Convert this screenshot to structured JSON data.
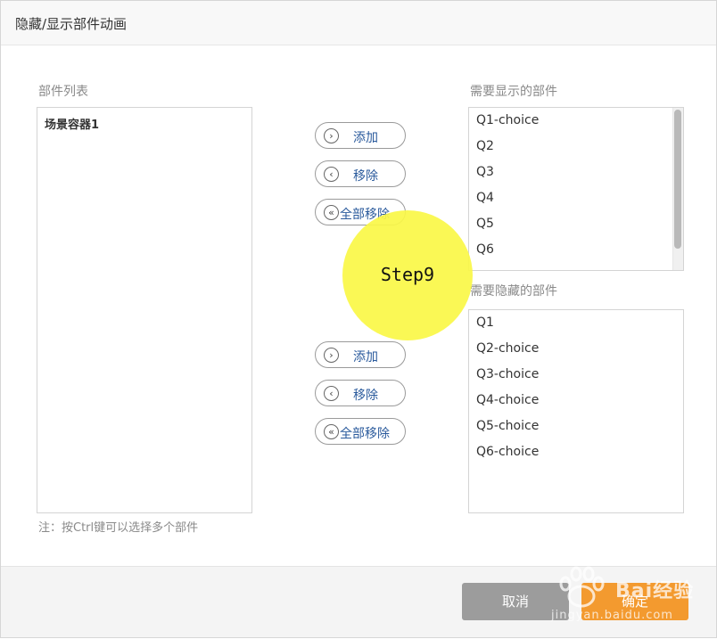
{
  "dialog": {
    "title": "隐藏/显示部件动画"
  },
  "left_panel": {
    "label": "部件列表",
    "items": [
      "场景容器1"
    ]
  },
  "show_panel": {
    "label": "需要显示的部件",
    "items": [
      "Q1-choice",
      "Q2",
      "Q3",
      "Q4",
      "Q5",
      "Q6"
    ]
  },
  "hide_panel": {
    "label": "需要隐藏的部件",
    "items": [
      "Q1",
      "Q2-choice",
      "Q3-choice",
      "Q4-choice",
      "Q5-choice",
      "Q6-choice"
    ]
  },
  "controls_show": {
    "add": "添加",
    "remove": "移除",
    "remove_all": "全部移除"
  },
  "controls_hide": {
    "add": "添加",
    "remove": "移除",
    "remove_all": "全部移除"
  },
  "icons": {
    "add": "chevron-right-circle-icon",
    "remove": "chevron-left-circle-icon",
    "remove_all": "double-chevron-left-circle-icon"
  },
  "note": "注：按Ctrl键可以选择多个部件",
  "footer": {
    "cancel": "取消",
    "ok": "确定"
  },
  "overlay": {
    "step": "Step9"
  },
  "watermark": {
    "brand": "Bai经验",
    "url": "jingyan.baidu.com"
  },
  "colors": {
    "ok_button": "#f39a2f",
    "cancel_button": "#9c9c9c",
    "step_circle": "#faf746",
    "button_label": "#2a5a9c"
  }
}
